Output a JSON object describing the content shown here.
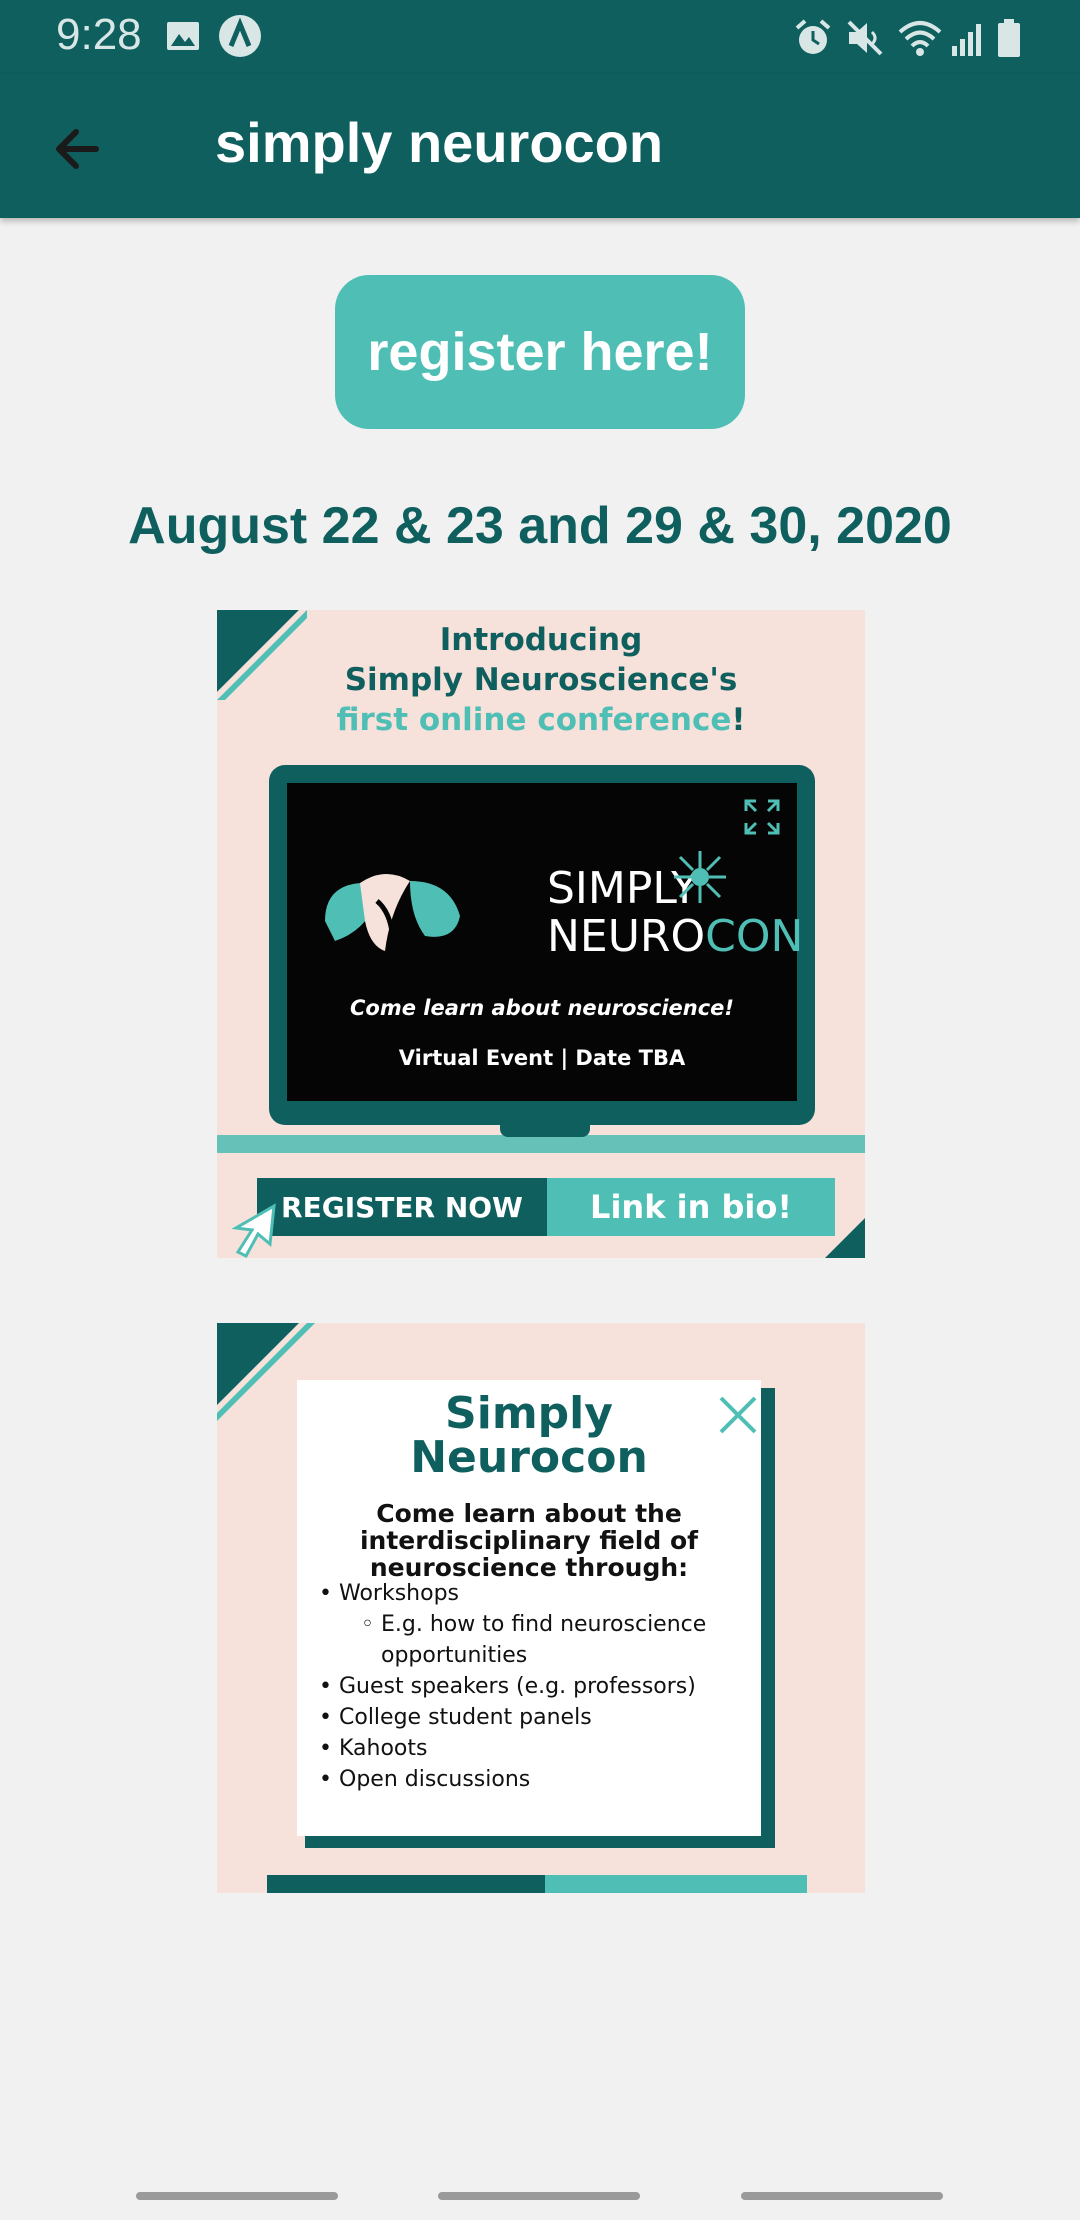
{
  "status_bar": {
    "time": "9:28",
    "icons": [
      "image-icon",
      "a-app-icon",
      "alarm-icon",
      "mute-icon",
      "wifi-icon",
      "signal-icon",
      "battery-icon"
    ]
  },
  "app_bar": {
    "title": "simply neurocon",
    "back_icon": "arrow-left-icon"
  },
  "content": {
    "register_button": "register here!",
    "dates": "August 22 & 23 and 29 & 30, 2020"
  },
  "poster1": {
    "intro_line1": "Introducing",
    "intro_line2": "Simply Neuroscience's",
    "intro_line3": "first online conference",
    "intro_line3_end": "!",
    "logo_line1": "SIMPLY",
    "logo_line2a": "NEURO",
    "logo_line2b": "CON",
    "tagline": "Come learn about neuroscience!",
    "event": "Virtual Event | Date TBA",
    "register_now": "REGISTER NOW",
    "link_in_bio": "Link in bio!"
  },
  "poster2": {
    "title_line1": "Simply",
    "title_line2": "Neurocon",
    "subtitle_line1": "Come learn about the",
    "subtitle_line2": "interdisciplinary field of",
    "subtitle_line3": "neuroscience through:",
    "items": [
      "Workshops",
      "Guest speakers (e.g. professors)",
      "College student panels",
      "Kahoots",
      "Open discussions"
    ],
    "subitem": "E.g. how to find neuroscience opportunities"
  },
  "colors": {
    "primary": "#0f5f5f",
    "accent": "#4fbfb6",
    "poster_bg": "#f6e1db",
    "page_bg": "#f1f1f1"
  }
}
